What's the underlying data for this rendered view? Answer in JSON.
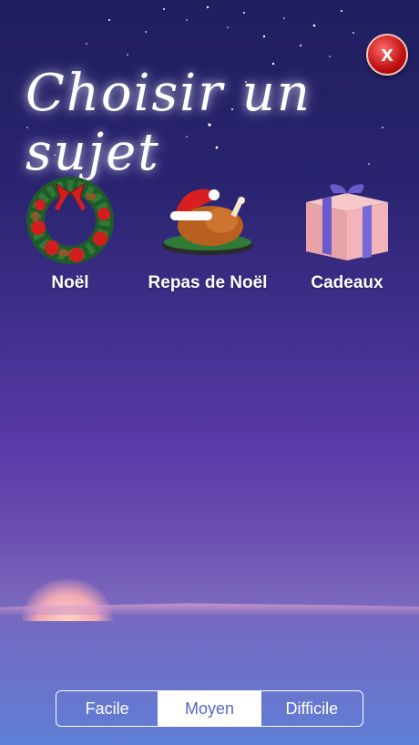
{
  "header": {
    "title": "Choisir un sujet",
    "close_label": "x"
  },
  "subjects": [
    {
      "label": "Noël",
      "icon": "christmas-wreath-icon"
    },
    {
      "label": "Repas de Noël",
      "icon": "roast-turkey-icon"
    },
    {
      "label": "Cadeaux",
      "icon": "gift-box-icon"
    }
  ],
  "difficulty": {
    "options": [
      "Facile",
      "Moyen",
      "Difficile"
    ],
    "selected": "Moyen"
  },
  "colors": {
    "sky_top": "#1f1f5e",
    "sky_bottom": "#5f7fd6",
    "close_red": "#c01010",
    "selected_text": "#5865c4"
  }
}
